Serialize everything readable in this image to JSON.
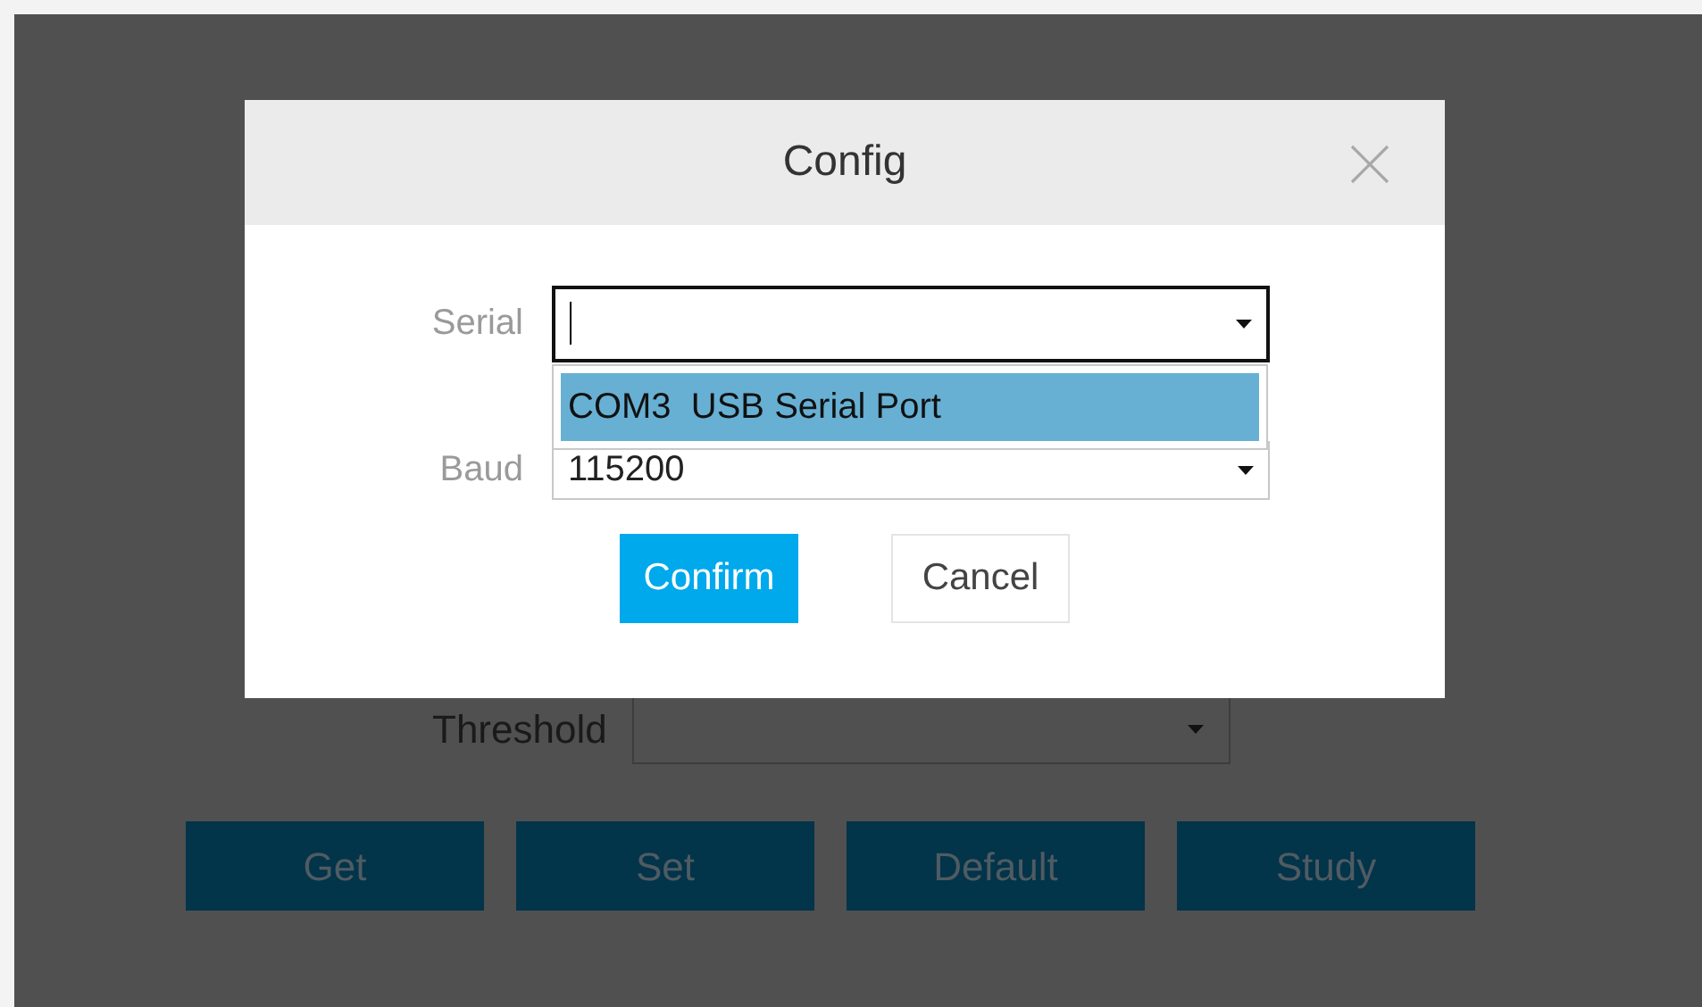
{
  "background_form": {
    "threshold": {
      "label": "Threshold"
    },
    "buttons": [
      "Get",
      "Set",
      "Default",
      "Study"
    ]
  },
  "dialog": {
    "title": "Config",
    "fields": [
      {
        "label": "Serial",
        "focused": true,
        "expanded": true,
        "options": [
          {
            "label": "COM3  USB Serial Port",
            "selected": true
          }
        ]
      },
      {
        "label": "Baud",
        "value": "115200",
        "focused": false,
        "expanded": false
      }
    ],
    "buttons": [
      {
        "label": "Confirm",
        "kind": "primary"
      },
      {
        "label": "Cancel",
        "kind": "secondary"
      }
    ]
  }
}
